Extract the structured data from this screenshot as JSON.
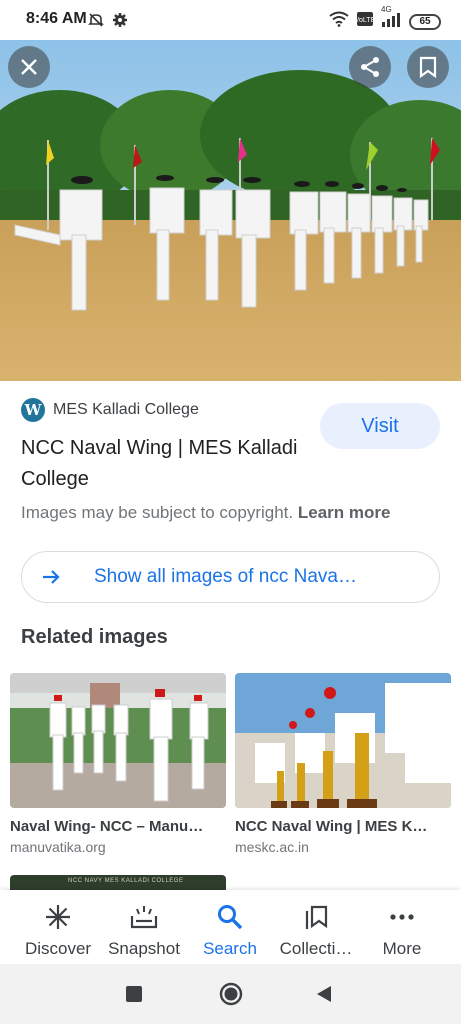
{
  "status_bar": {
    "time": "8:46 AM",
    "battery": "65",
    "network": "4G",
    "icons": [
      "mute-icon",
      "gear-icon",
      "wifi-icon",
      "volte-icon",
      "signal-icon",
      "battery-icon"
    ]
  },
  "hero": {
    "buttons": [
      "close-icon",
      "share-icon",
      "bookmark-icon"
    ]
  },
  "result": {
    "source": "MES Kalladi College",
    "title": "NCC Naval Wing | MES Kalladi College",
    "visit_label": "Visit",
    "copyright_text": "Images may be subject to copyright.",
    "learn_more": "Learn more"
  },
  "show_all_label": "Show all images of ncc Nava…",
  "related": {
    "heading": "Related images",
    "items": [
      {
        "title": "Naval Wing- NCC – Manu…",
        "domain": "manuvatika.org"
      },
      {
        "title": "NCC Naval Wing | MES K…",
        "domain": "meskc.ac.in"
      }
    ],
    "partial_banner": "NCC NAVY MES KALLADI COLLEGE"
  },
  "bottom_nav": [
    {
      "label": "Discover",
      "icon": "asterisk-icon"
    },
    {
      "label": "Snapshot",
      "icon": "snapshot-icon"
    },
    {
      "label": "Search",
      "icon": "search-icon",
      "active": true
    },
    {
      "label": "Collecti…",
      "icon": "collections-icon"
    },
    {
      "label": "More",
      "icon": "more-dots-icon"
    }
  ],
  "colors": {
    "accent": "#1a73e8",
    "visit_bg": "#e8f0fe",
    "wordpress": "#21759b"
  }
}
